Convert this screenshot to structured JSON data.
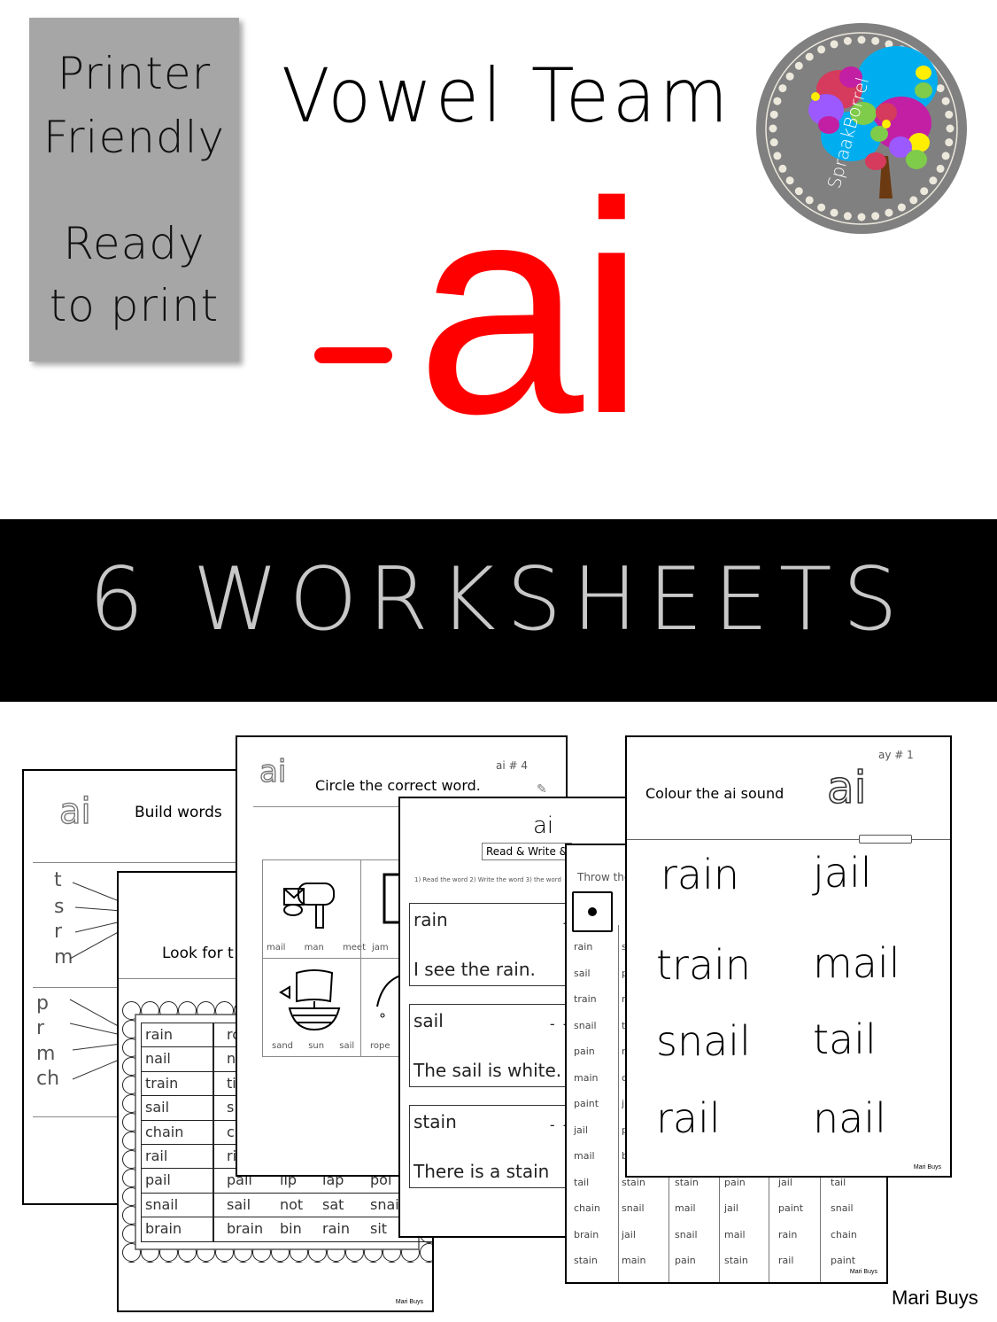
{
  "colors": {
    "accent_red": "#ff0000",
    "band_bg": "#000000",
    "band_text": "#c8c8c8",
    "promo_bg": "#a6a6a6",
    "logo_bg": "#808080"
  },
  "promo": {
    "lines": [
      "Printer",
      "Friendly",
      "Ready",
      "to print"
    ]
  },
  "header": {
    "title": "Vowel Team",
    "dash": "-",
    "sound": "ai"
  },
  "logo": {
    "text": "SpraakBorrel",
    "icon": "speech-bubble-tree-icon"
  },
  "band": {
    "text": "6 WORKSHEETS"
  },
  "signature": "Mari Buys",
  "worksheets": {
    "build_words": {
      "sound": "ai",
      "title": "Build words",
      "group1": [
        "t",
        "s",
        "r",
        "m"
      ],
      "group2": [
        "p",
        "r",
        "m",
        "ch"
      ]
    },
    "look_for": {
      "title": "Look for t",
      "rows": [
        [
          "rain",
          "rc"
        ],
        [
          "nail",
          "n"
        ],
        [
          "train",
          "ti"
        ],
        [
          "sail",
          "s"
        ],
        [
          "chain",
          "c"
        ],
        [
          "rail",
          "ri"
        ],
        [
          "pail",
          "pail",
          "lip",
          "lap",
          "poi"
        ],
        [
          "snail",
          "sail",
          "not",
          "sat",
          "snai"
        ],
        [
          "brain",
          "brain",
          "bin",
          "rain",
          "sit"
        ]
      ],
      "footer": "Mari Buys"
    },
    "circle_word": {
      "sound": "ai",
      "number": "ai # 4",
      "title": "Circle the correct word.",
      "cells": [
        {
          "icon": "mailbox-icon",
          "options": [
            "mail",
            "man",
            "meet"
          ]
        },
        {
          "icon": "door-icon",
          "options": [
            "jam"
          ]
        },
        {
          "icon": "ship-icon",
          "options": [
            "sand",
            "sun",
            "sail"
          ]
        },
        {
          "icon": "umbrella-icon",
          "options": [
            "rope"
          ]
        }
      ]
    },
    "read_write": {
      "sound": "ai",
      "badge": "Read & Write &",
      "instructions": "1)   Read the word  2) Write the word  3) the word",
      "items": [
        {
          "word": "rain",
          "dashes": "- - - - -",
          "sentence": "I see the rain."
        },
        {
          "word": "sail",
          "dashes": "- - - - - -",
          "sentence": "The sail is white."
        },
        {
          "word": "stain",
          "dashes": "- - - - - -",
          "sentence": "There is a stain"
        }
      ]
    },
    "dice": {
      "title": "Throw the",
      "die_icon": "die-one-icon",
      "columns": [
        [
          "rain",
          "sail",
          "train",
          "snail",
          "pain",
          "main",
          "paint",
          "jail",
          "mail",
          "tail",
          "chain",
          "brain",
          "stain"
        ],
        [
          "s",
          "p",
          "r",
          "t",
          "r",
          "c",
          "j",
          "p",
          "b",
          "stain",
          "snail",
          "jail",
          "main"
        ],
        [
          "stain",
          "mail",
          "snail",
          "pain"
        ],
        [
          "pain",
          "jail",
          "mail",
          "stain"
        ],
        [
          "jail",
          "paint",
          "rain",
          "rail"
        ],
        [
          "tail",
          "snail",
          "chain",
          "paint"
        ]
      ],
      "footer": "Mari Buys"
    },
    "colour_sound": {
      "number": "ay # 1",
      "title": "Colour the ai sound",
      "sound": "ai",
      "words": [
        "rain",
        "jail",
        "train",
        "mail",
        "snail",
        "tail",
        "rail",
        "nail"
      ],
      "footer": "Mari Buys"
    }
  }
}
